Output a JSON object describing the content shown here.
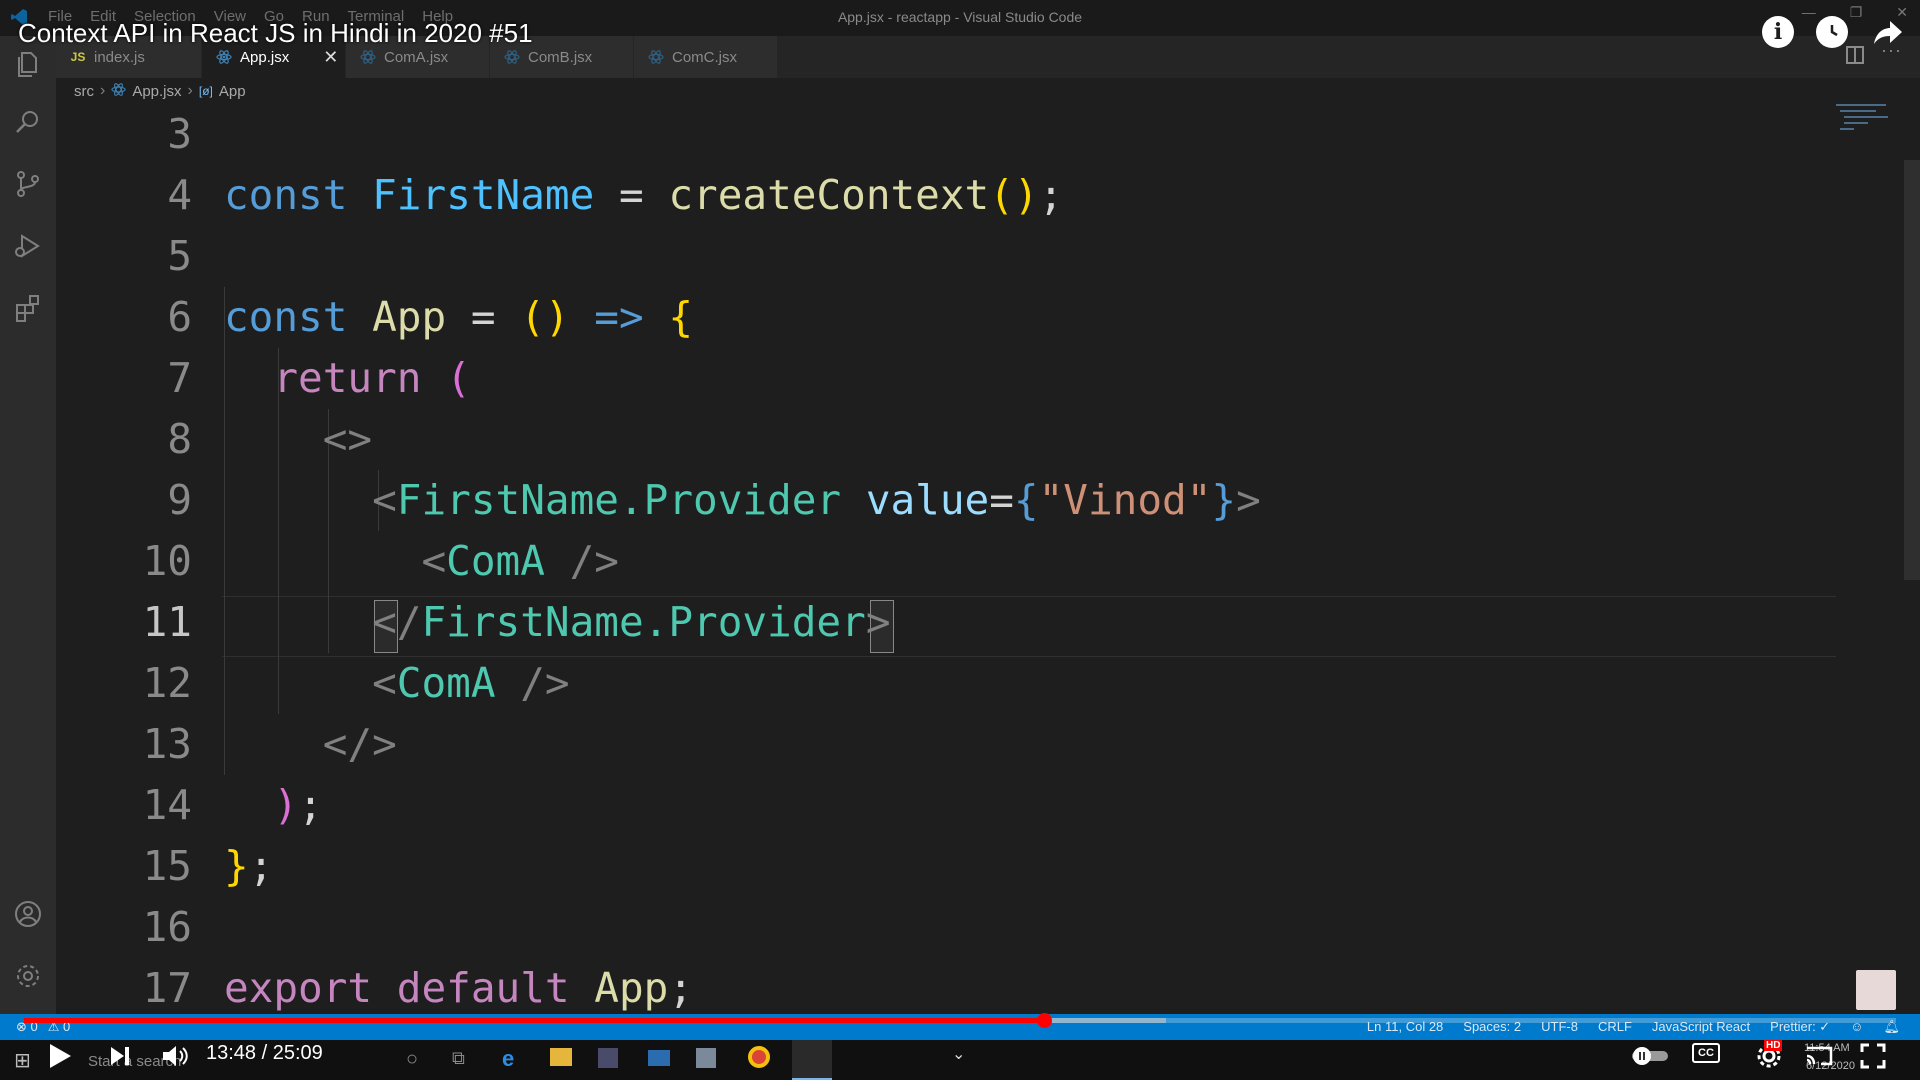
{
  "window": {
    "title": "App.jsx - reactapp - Visual Studio Code",
    "menu": [
      "File",
      "Edit",
      "Selection",
      "View",
      "Go",
      "Run",
      "Terminal",
      "Help"
    ]
  },
  "video": {
    "title": "Context API in React JS in Hindi in 2020 #51",
    "time": "13:48 / 25:09",
    "progress_played": 0.545,
    "progress_loaded": 0.61,
    "cc_label": "CC",
    "hd_label": "HD"
  },
  "tabs": [
    {
      "label": "index.js",
      "icon": "JS",
      "active": false
    },
    {
      "label": "App.jsx",
      "icon": "react-icon",
      "active": true
    },
    {
      "label": "ComA.jsx",
      "icon": "react-icon",
      "active": false
    },
    {
      "label": "ComB.jsx",
      "icon": "react-icon",
      "active": false
    },
    {
      "label": "ComC.jsx",
      "icon": "react-icon",
      "active": false
    }
  ],
  "breadcrumb": [
    "src",
    "App.jsx",
    "App"
  ],
  "editor": {
    "current_line": 11,
    "lines": [
      "3",
      "4",
      "5",
      "6",
      "7",
      "8",
      "9",
      "10",
      "11",
      "12",
      "13",
      "14",
      "15",
      "16",
      "17"
    ]
  },
  "status": {
    "left": [
      "⊗ 0",
      "⚠ 0"
    ],
    "position": "Ln 11, Col 28",
    "spaces": "Spaces: 2",
    "encoding": "UTF-8",
    "eol": "CRLF",
    "language": "JavaScript React",
    "prettier": "Prettier: ✓"
  },
  "taskbar": {
    "search_placeholder": "Start a search",
    "clock": "11:54 AM",
    "date": "6/12/2020"
  },
  "colors": {
    "status_bar": "#007acc",
    "progress_red": "#ff0000",
    "editor_bg": "#1e1e1e"
  }
}
